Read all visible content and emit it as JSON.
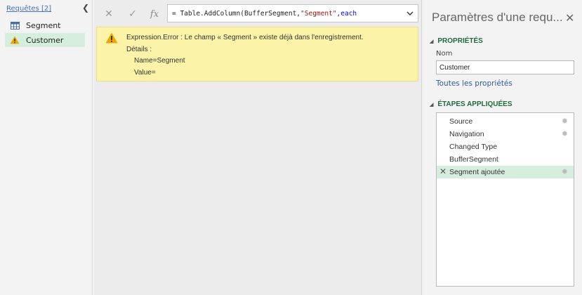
{
  "queries": {
    "header": "Requêtes [2]",
    "collapse_icon": "chevron-left",
    "items": [
      {
        "label": "Segment",
        "icon": "table-icon",
        "selected": false
      },
      {
        "label": "Customer",
        "icon": "warning-icon",
        "selected": true
      }
    ]
  },
  "formula_bar": {
    "cancel_icon": "close-icon",
    "commit_icon": "check-icon",
    "fx_label": "fx",
    "prefix": "= Table.AddColumn(BufferSegment, ",
    "string_arg": "\"Segment\"",
    "sep": ", ",
    "keyword": "each",
    "expand_icon": "chevron-down-icon"
  },
  "error": {
    "icon": "warning-icon",
    "line1": "Expression.Error : Le champ « Segment » existe déjà dans l'enregistrement.",
    "line2": "Détails :",
    "line3": "Name=Segment",
    "line4": "Value="
  },
  "properties_panel": {
    "title": "Paramètres d'une requ...",
    "close_icon": "close-icon",
    "properties_header": "PROPRIÉTÉS",
    "name_label": "Nom",
    "name_value": "Customer",
    "all_properties_link": "Toutes les propriétés",
    "applied_steps_header": "ÉTAPES APPLIQUÉES",
    "steps": [
      {
        "label": "Source",
        "has_gear": true,
        "selected": false
      },
      {
        "label": "Navigation",
        "has_gear": true,
        "selected": false
      },
      {
        "label": "Changed Type",
        "has_gear": false,
        "selected": false
      },
      {
        "label": "BufferSegment",
        "has_gear": false,
        "selected": false
      },
      {
        "label": "Segment ajoutée",
        "has_gear": true,
        "selected": true
      }
    ]
  },
  "colors": {
    "selection": "#d6eedd",
    "error_bg": "#faf3a8",
    "section_header": "#1e6b3a",
    "link": "#2d5c9a",
    "warning": "#f0a500"
  }
}
